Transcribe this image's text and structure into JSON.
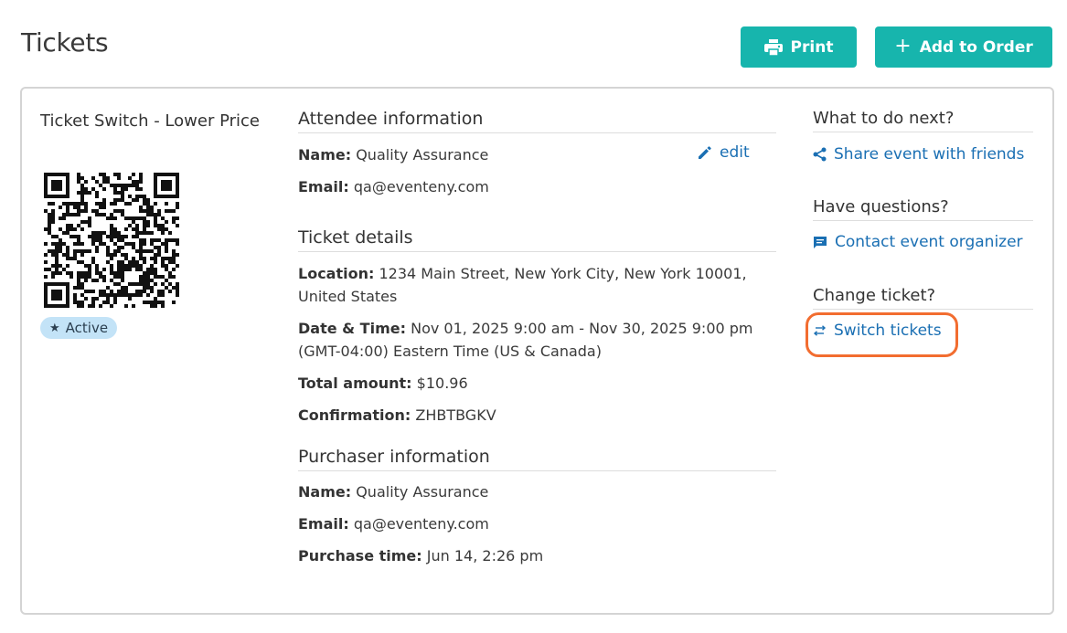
{
  "header": {
    "title": "Tickets",
    "print_label": "Print",
    "add_to_order_label": "Add to Order",
    "accent_color": "#17b5ad"
  },
  "ticket": {
    "name": "Ticket Switch - Lower Price",
    "status": "Active",
    "qr_icon": "qr-code-icon"
  },
  "attendee": {
    "heading": "Attendee information",
    "name_label": "Name:",
    "name_value": "Quality Assurance",
    "email_label": "Email:",
    "email_value": "qa@eventeny.com",
    "edit_label": "edit"
  },
  "details": {
    "heading": "Ticket details",
    "location_label": "Location:",
    "location_value": "1234 Main Street, New York City, New York 10001, United States",
    "datetime_label": "Date & Time:",
    "datetime_value": "Nov 01, 2025 9:00 am - Nov 30, 2025 9:00 pm (GMT-04:00) Eastern Time (US & Canada)",
    "total_label": "Total amount:",
    "total_value": "$10.96",
    "confirmation_label": "Confirmation:",
    "confirmation_value": "ZHBTBGKV"
  },
  "purchaser": {
    "heading": "Purchaser information",
    "name_label": "Name:",
    "name_value": "Quality Assurance",
    "email_label": "Email:",
    "email_value": "qa@eventeny.com",
    "time_label": "Purchase time:",
    "time_value": "Jun 14, 2:26 pm"
  },
  "sidebar": {
    "next_heading": "What to do next?",
    "share_label": "Share event with friends",
    "questions_heading": "Have questions?",
    "contact_label": "Contact event organizer",
    "change_heading": "Change ticket?",
    "switch_label": "Switch tickets",
    "highlight_color": "#f26d30",
    "link_color": "#1a6fb3"
  }
}
